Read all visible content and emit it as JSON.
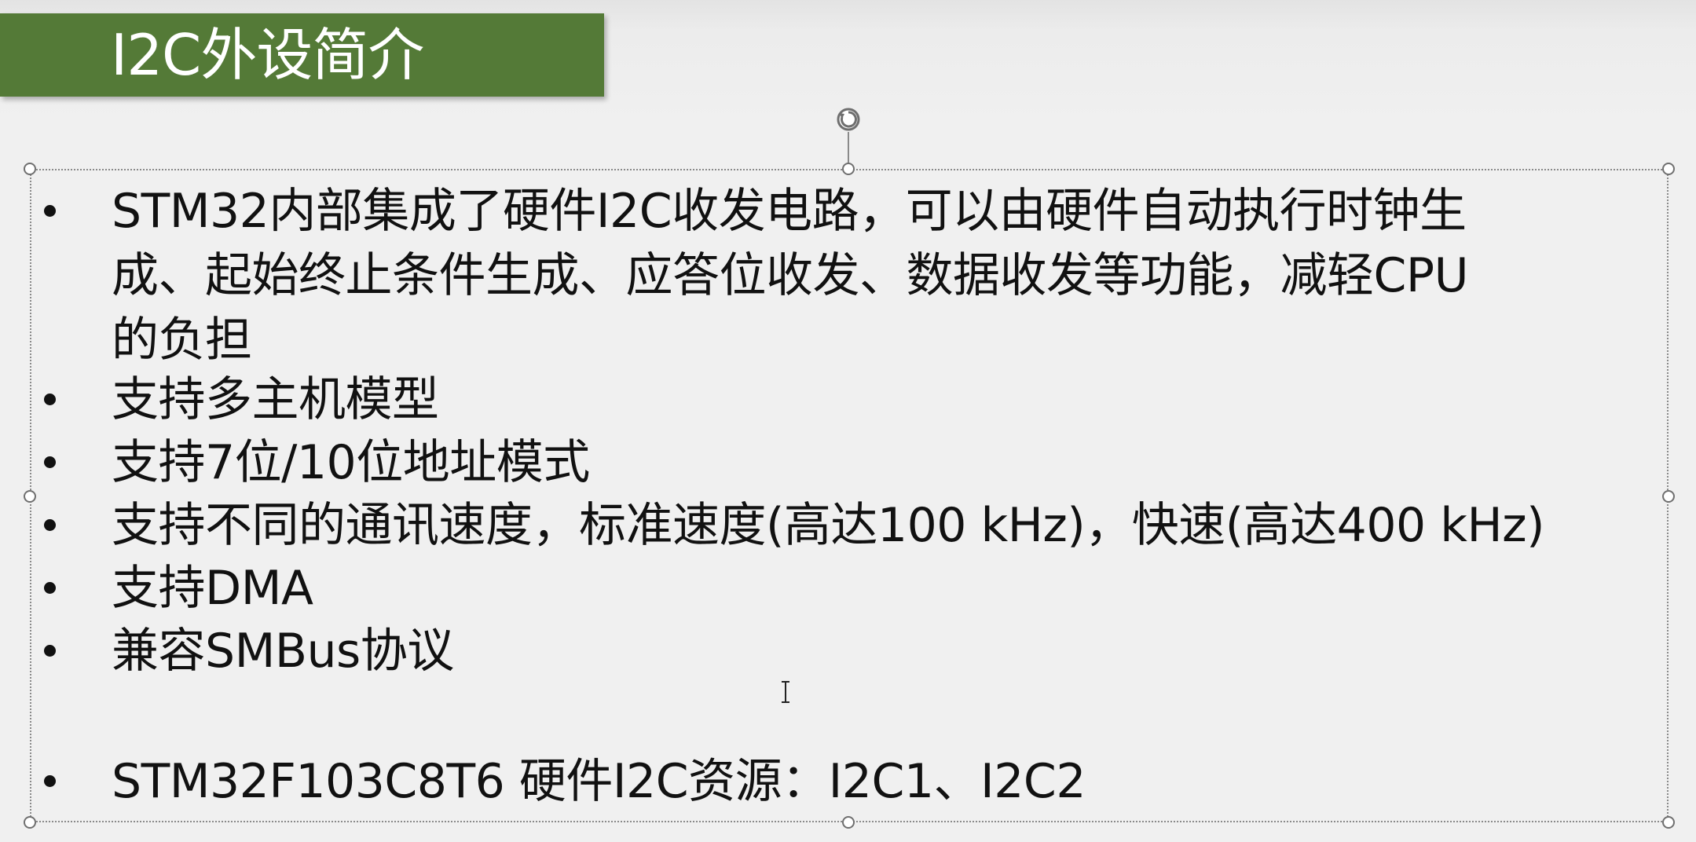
{
  "slide": {
    "title": "I2C外设简介",
    "bullets": [
      {
        "lines": [
          "STM32内部集成了硬件I2C收发电路，可以由硬件自动执行时钟生",
          "成、起始终止条件生成、应答位收发、数据收发等功能，减轻CPU",
          "的负担"
        ]
      },
      {
        "lines": [
          "支持多主机模型"
        ]
      },
      {
        "lines": [
          "支持7位/10位地址模式"
        ]
      },
      {
        "lines": [
          "支持不同的通讯速度，标准速度(高达100 kHz)，快速(高达400 kHz)"
        ]
      },
      {
        "lines": [
          "支持DMA"
        ]
      },
      {
        "lines": [
          "兼容SMBus协议"
        ]
      },
      {
        "lines": [
          "STM32F103C8T6 硬件I2C资源：I2C1、I2C2"
        ]
      }
    ]
  },
  "colors": {
    "title_bar": "#547a37",
    "title_text": "#ffffff",
    "background": "#f0f0f0",
    "body_text": "#111111"
  },
  "icons": {
    "rotate": "rotate-handle-icon",
    "cursor": "text-cursor-icon"
  }
}
